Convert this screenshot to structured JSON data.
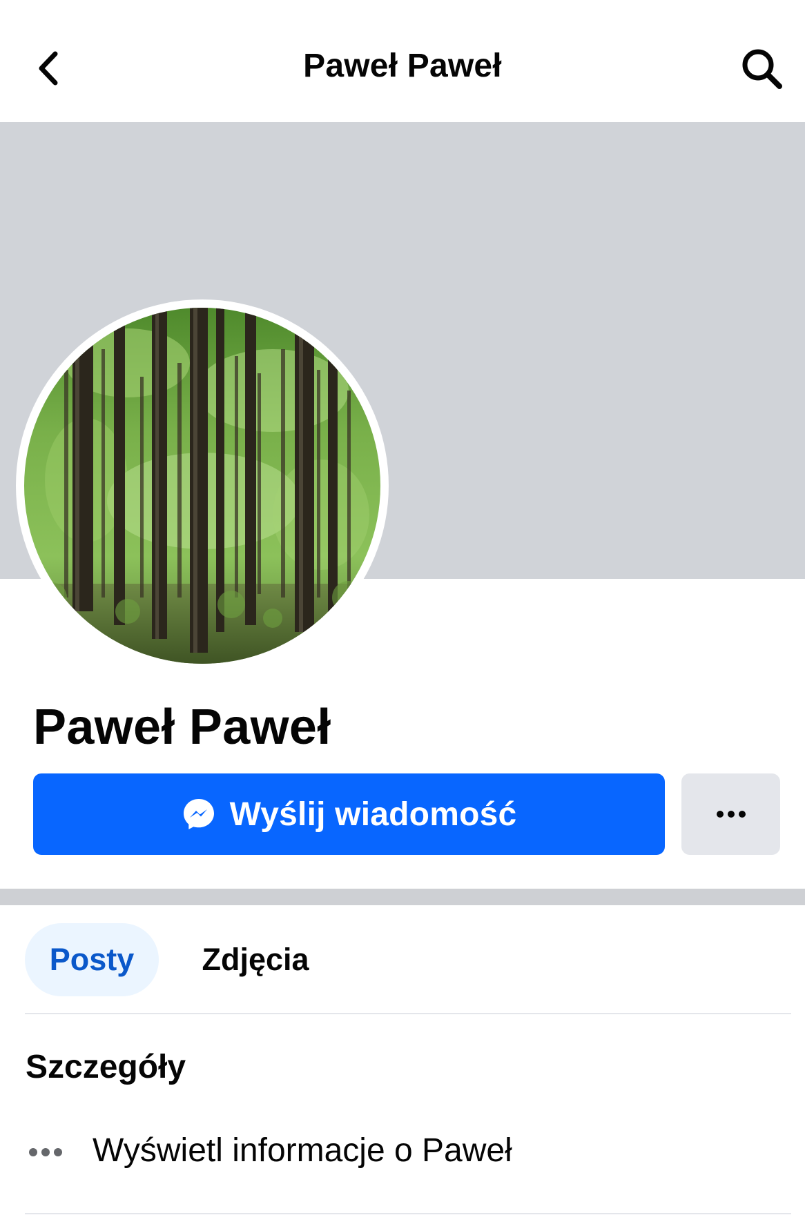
{
  "header": {
    "title": "Paweł Paweł",
    "back_icon": "chevron-left-icon",
    "search_icon": "search-icon"
  },
  "profile": {
    "name": "Paweł Paweł",
    "avatar": "forest-photo"
  },
  "actions": {
    "message_label": "Wyślij wiadomość",
    "message_icon": "messenger-icon",
    "more_icon": "more-horizontal-icon"
  },
  "tabs": [
    {
      "label": "Posty",
      "active": true
    },
    {
      "label": "Zdjęcia",
      "active": false
    }
  ],
  "details": {
    "title": "Szczegóły",
    "items": [
      {
        "label": "Wyświetl informacje o Paweł",
        "icon": "more-horizontal-icon"
      }
    ]
  },
  "colors": {
    "primary": "#0866ff",
    "cover": "#d0d3d8",
    "secondary_button": "#e4e6eb",
    "active_tab_bg": "#ebf5ff",
    "active_tab_text": "#0a58ca"
  }
}
